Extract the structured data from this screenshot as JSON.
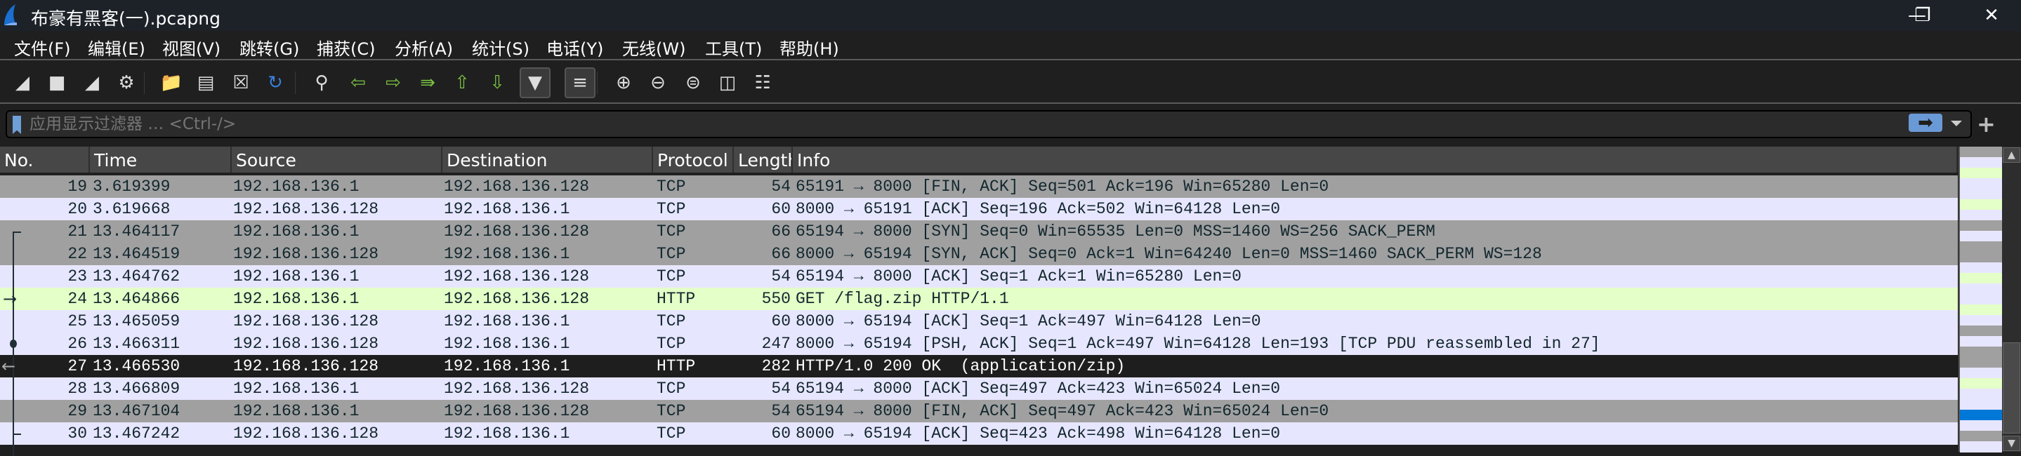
{
  "window": {
    "title": "布豪有黑客(一).pcapng",
    "minimize": "—",
    "restore": "❐",
    "close": "✕"
  },
  "menu": [
    "文件(F)",
    "编辑(E)",
    "视图(V)",
    "跳转(G)",
    "捕获(C)",
    "分析(A)",
    "统计(S)",
    "电话(Y)",
    "无线(W)",
    "工具(T)",
    "帮助(H)"
  ],
  "toolbar": [
    {
      "name": "start-capture-icon",
      "glyph": "◢"
    },
    {
      "name": "stop-capture-icon",
      "glyph": "■"
    },
    {
      "name": "restart-capture-icon",
      "glyph": "◢"
    },
    {
      "name": "capture-options-icon",
      "glyph": "⚙"
    },
    {
      "name": "open-file-icon",
      "glyph": "📁"
    },
    {
      "name": "save-file-icon",
      "glyph": "▤"
    },
    {
      "name": "close-file-icon",
      "glyph": "☒"
    },
    {
      "name": "reload-file-icon",
      "glyph": "↻"
    },
    {
      "name": "find-packet-icon",
      "glyph": "⚲"
    },
    {
      "name": "go-back-icon",
      "glyph": "⇦"
    },
    {
      "name": "go-forward-icon",
      "glyph": "⇨"
    },
    {
      "name": "go-to-packet-icon",
      "glyph": "⇛"
    },
    {
      "name": "go-first-icon",
      "glyph": "⇧"
    },
    {
      "name": "go-last-icon",
      "glyph": "⇩"
    },
    {
      "name": "autoscroll-icon",
      "glyph": "▼"
    },
    {
      "name": "colorize-icon",
      "glyph": "≡"
    },
    {
      "name": "zoom-in-icon",
      "glyph": "⊕"
    },
    {
      "name": "zoom-out-icon",
      "glyph": "⊖"
    },
    {
      "name": "normal-size-icon",
      "glyph": "⊜"
    },
    {
      "name": "resize-columns-icon",
      "glyph": "◫"
    },
    {
      "name": "layout-icon",
      "glyph": "☷"
    }
  ],
  "filter": {
    "placeholder": "应用显示过滤器 … <Ctrl-/>",
    "value": ""
  },
  "columns": [
    "No.",
    "Time",
    "Source",
    "Destination",
    "Protocol",
    "Length",
    "Info"
  ],
  "packets": [
    {
      "no": "19",
      "time": "3.619399",
      "src": "192.168.136.1",
      "dst": "192.168.136.128",
      "proto": "TCP",
      "len": "54",
      "info": "65191 → 8000 [FIN, ACK] Seq=501 Ack=196 Win=65280 Len=0",
      "color": "#a0a0a0"
    },
    {
      "no": "20",
      "time": "3.619668",
      "src": "192.168.136.128",
      "dst": "192.168.136.1",
      "proto": "TCP",
      "len": "60",
      "info": "8000 → 65191 [ACK] Seq=196 Ack=502 Win=64128 Len=0",
      "color": "#e7e6ff"
    },
    {
      "no": "21",
      "time": "13.464117",
      "src": "192.168.136.1",
      "dst": "192.168.136.128",
      "proto": "TCP",
      "len": "66",
      "info": "65194 → 8000 [SYN] Seq=0 Win=65535 Len=0 MSS=1460 WS=256 SACK_PERM",
      "color": "#a0a0a0"
    },
    {
      "no": "22",
      "time": "13.464519",
      "src": "192.168.136.128",
      "dst": "192.168.136.1",
      "proto": "TCP",
      "len": "66",
      "info": "8000 → 65194 [SYN, ACK] Seq=0 Ack=1 Win=64240 Len=0 MSS=1460 SACK_PERM WS=128",
      "color": "#a0a0a0"
    },
    {
      "no": "23",
      "time": "13.464762",
      "src": "192.168.136.1",
      "dst": "192.168.136.128",
      "proto": "TCP",
      "len": "54",
      "info": "65194 → 8000 [ACK] Seq=1 Ack=1 Win=65280 Len=0",
      "color": "#e7e6ff"
    },
    {
      "no": "24",
      "time": "13.464866",
      "src": "192.168.136.1",
      "dst": "192.168.136.128",
      "proto": "HTTP",
      "len": "550",
      "info": "GET /flag.zip HTTP/1.1",
      "color": "#e4ffc7"
    },
    {
      "no": "25",
      "time": "13.465059",
      "src": "192.168.136.128",
      "dst": "192.168.136.1",
      "proto": "TCP",
      "len": "60",
      "info": "8000 → 65194 [ACK] Seq=1 Ack=497 Win=64128 Len=0",
      "color": "#e7e6ff"
    },
    {
      "no": "26",
      "time": "13.466311",
      "src": "192.168.136.128",
      "dst": "192.168.136.1",
      "proto": "TCP",
      "len": "247",
      "info": "8000 → 65194 [PSH, ACK] Seq=1 Ack=497 Win=64128 Len=193 [TCP PDU reassembled in 27]",
      "color": "#e7e6ff"
    },
    {
      "no": "27",
      "time": "13.466530",
      "src": "192.168.136.128",
      "dst": "192.168.136.1",
      "proto": "HTTP",
      "len": "282",
      "info": "HTTP/1.0 200 OK  (application/zip)",
      "color": "#1e1e1e",
      "selected": true
    },
    {
      "no": "28",
      "time": "13.466809",
      "src": "192.168.136.1",
      "dst": "192.168.136.128",
      "proto": "TCP",
      "len": "54",
      "info": "65194 → 8000 [ACK] Seq=497 Ack=423 Win=65024 Len=0",
      "color": "#e7e6ff"
    },
    {
      "no": "29",
      "time": "13.467104",
      "src": "192.168.136.1",
      "dst": "192.168.136.128",
      "proto": "TCP",
      "len": "54",
      "info": "65194 → 8000 [FIN, ACK] Seq=497 Ack=423 Win=65024 Len=0",
      "color": "#a0a0a0"
    },
    {
      "no": "30",
      "time": "13.467242",
      "src": "192.168.136.128",
      "dst": "192.168.136.1",
      "proto": "TCP",
      "len": "60",
      "info": "8000 → 65194 [ACK] Seq=423 Ack=498 Win=64128 Len=0",
      "color": "#e7e6ff"
    }
  ],
  "minimap": [
    "#a0a0a0",
    "#e7e6ff",
    "#e4ffc7",
    "#e7e6ff",
    "#e7e6ff",
    "#e4ffc7",
    "#e7e6ff",
    "#a0a0a0",
    "#e7e6ff",
    "#a0a0a0",
    "#a0a0a0",
    "#e7e6ff",
    "#e4ffc7",
    "#e7e6ff",
    "#e7e6ff",
    "#e4ffc7",
    "#e7e6ff",
    "#a0a0a0",
    "#e7e6ff",
    "#a0a0a0",
    "#a0a0a0",
    "#e7e6ff",
    "#e4ffc7",
    "#e7e6ff",
    "#e7e6ff",
    "#0078d7",
    "#e7e6ff",
    "#a0a0a0",
    "#e7e6ff"
  ],
  "colors": {
    "selected": "#1e1e1e",
    "minimap_selected": "#0078d7"
  }
}
